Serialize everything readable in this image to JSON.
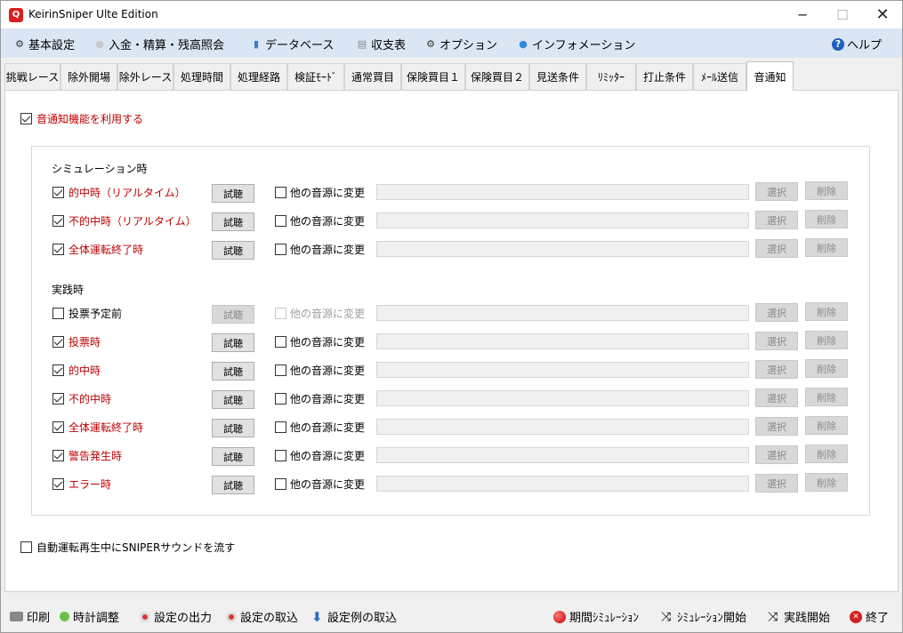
{
  "window": {
    "title": "KeirinSniper Ulte Edition",
    "min": "─",
    "max": "☐",
    "close": "✕"
  },
  "menu": [
    {
      "label": "基本設定",
      "icon": "gear-icon",
      "glyph": "⚙"
    },
    {
      "label": "入金・精算・残高照会",
      "icon": "coin-icon",
      "glyph": "●"
    },
    {
      "label": "データベース",
      "icon": "database-icon",
      "glyph": "▮"
    },
    {
      "label": "収支表",
      "icon": "document-icon",
      "glyph": "▤"
    },
    {
      "label": "オプション",
      "icon": "gear-icon",
      "glyph": "⚙"
    },
    {
      "label": "インフォメーション",
      "icon": "chat-bubble-icon",
      "glyph": "●"
    },
    {
      "label": "ヘルプ",
      "icon": "help-icon",
      "glyph": "?"
    }
  ],
  "tabs": [
    "挑戦レース",
    "除外開場",
    "除外レース",
    "処理時間",
    "処理経路",
    "検証ﾓｰﾄﾞ",
    "通常買目",
    "保険買目１",
    "保険買目２",
    "見送条件",
    "ﾘﾐｯﾀｰ",
    "打止条件",
    "ﾒｰﾙ送信",
    "音通知"
  ],
  "active_tab": "音通知",
  "enable_sound": {
    "label": "音通知機能を利用する",
    "checked": true
  },
  "simulation": {
    "heading": "シミュレーション時",
    "rows": [
      {
        "label": "的中時（リアルタイム）",
        "checked": true
      },
      {
        "label": "不的中時（リアルタイム）",
        "checked": true
      },
      {
        "label": "全体運転終了時",
        "checked": true
      }
    ]
  },
  "practice": {
    "heading": "実践時",
    "rows": [
      {
        "label": "投票予定前",
        "checked": false
      },
      {
        "label": "投票時",
        "checked": true
      },
      {
        "label": "的中時",
        "checked": true
      },
      {
        "label": "不的中時",
        "checked": true
      },
      {
        "label": "全体運転終了時",
        "checked": true
      },
      {
        "label": "警告発生時",
        "checked": true
      },
      {
        "label": "エラー時",
        "checked": true
      }
    ]
  },
  "row_controls": {
    "listen": "試聴",
    "change_source": "他の音源に変更",
    "select": "選択",
    "delete": "削除"
  },
  "sniper_sound": {
    "label": "自動運転再生中にSNIPERサウンドを流す",
    "checked": false
  },
  "bottom_left": [
    {
      "label": "印刷",
      "icon": "printer-icon"
    },
    {
      "label": "時計調整",
      "icon": "clock-icon"
    },
    {
      "label": "設定の出力",
      "icon": "export-icon"
    },
    {
      "label": "設定の取込",
      "icon": "import-icon"
    },
    {
      "label": "設定例の取込",
      "icon": "download-arrow-icon"
    }
  ],
  "bottom_right": [
    {
      "label": "期間ｼﾐｭﾚｰｼｮﾝ",
      "icon": "red-ball-icon"
    },
    {
      "label": "ｼﾐｭﾚｰｼｮﾝ開始",
      "icon": "shuffle-icon"
    },
    {
      "label": "実践開始",
      "icon": "shuffle-icon"
    },
    {
      "label": "終了",
      "icon": "close-circle-icon"
    }
  ],
  "colors": {
    "accent_red": "#c00000",
    "menu_bg": "#dbe6f4",
    "app_icon": "#d9201f"
  }
}
